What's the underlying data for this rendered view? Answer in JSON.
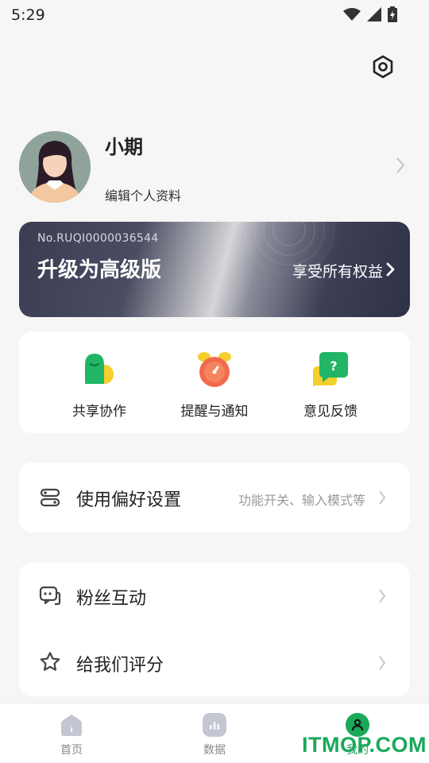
{
  "status_bar": {
    "time": "5:29"
  },
  "profile": {
    "name": "小期",
    "edit_label": "编辑个人资料"
  },
  "premium": {
    "number": "No.RUQI0000036544",
    "title": "升级为高级版",
    "link": "享受所有权益"
  },
  "quick_actions": [
    {
      "label": "共享协作",
      "icon": "share-collab-icon"
    },
    {
      "label": "提醒与通知",
      "icon": "alarm-clock-icon"
    },
    {
      "label": "意见反馈",
      "icon": "feedback-chat-icon"
    }
  ],
  "preferences": {
    "label": "使用偏好设置",
    "hint": "功能开关、输入模式等",
    "icon": "toggle-settings-icon"
  },
  "social": [
    {
      "label": "粉丝互动",
      "icon": "chat-bubble-icon"
    },
    {
      "label": "给我们评分",
      "icon": "star-icon"
    }
  ],
  "bottom_nav": [
    {
      "label": "首页",
      "icon": "home-icon",
      "active": false
    },
    {
      "label": "数据",
      "icon": "data-chart-icon",
      "active": false
    },
    {
      "label": "我的",
      "icon": "profile-icon",
      "active": true
    }
  ],
  "watermark": "ITMOP.COM",
  "colors": {
    "accent": "#1aa85a",
    "background": "#f6f6f6",
    "card": "#ffffff"
  }
}
